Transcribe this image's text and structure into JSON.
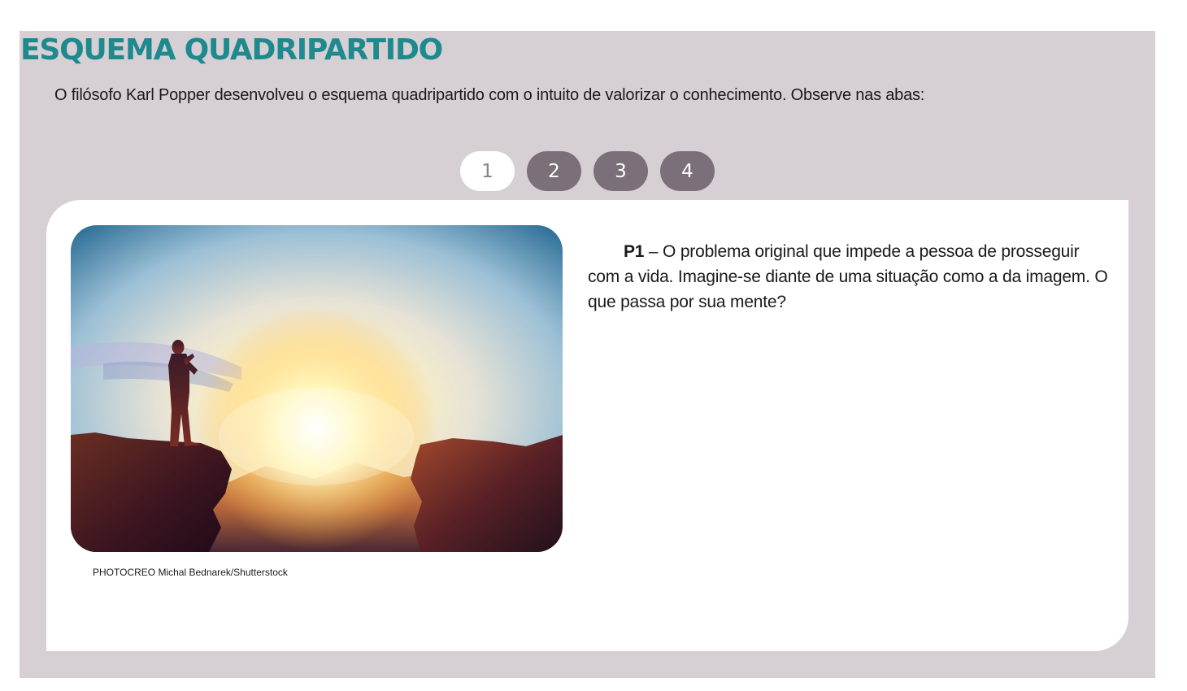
{
  "header": {
    "title": "ESQUEMA QUADRIPARTIDO",
    "intro": "O filósofo Karl Popper desenvolveu o esquema quadripartido com o intuito de valorizar o conhecimento. Observe nas abas:"
  },
  "tabs": [
    {
      "label": "1",
      "active": true
    },
    {
      "label": "2",
      "active": false
    },
    {
      "label": "3",
      "active": false
    },
    {
      "label": "4",
      "active": false
    }
  ],
  "content": {
    "image_credit": "PHOTOCREO Michal Bednarek/Shutterstock",
    "lead": "P1",
    "text": " – O problema original que impede a pessoa de prosseguir com a vida. Imagine-se diante de uma situação como a da imagem. O que passa por sua mente?"
  },
  "colors": {
    "title": "#1e8a8e",
    "panel_background": "#d6d0d5",
    "tab_inactive": "#7b7079",
    "tab_active": "#ffffff"
  }
}
